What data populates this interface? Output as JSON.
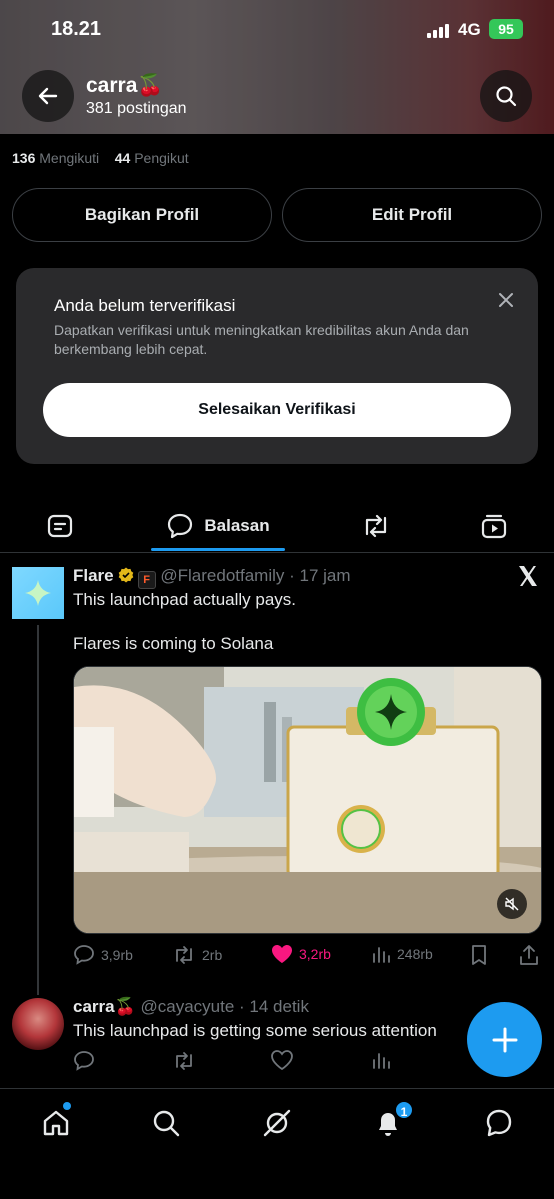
{
  "status_bar": {
    "time": "18.21",
    "network": "4G",
    "battery": "95"
  },
  "profile": {
    "name": "carra🍒",
    "posts": "381 postingan",
    "following_count": "136",
    "following_label": "Mengikuti",
    "followers_count": "44",
    "followers_label": "Pengikut"
  },
  "buttons": {
    "share": "Bagikan Profil",
    "edit": "Edit Profil"
  },
  "verification_card": {
    "title": "Anda belum terverifikasi",
    "description": "Dapatkan verifikasi untuk meningkatkan kredibilitas akun Anda dan berkembang lebih cepat.",
    "button": "Selesaikan Verifikasi"
  },
  "tabs": {
    "active_label": "Balasan"
  },
  "post": {
    "name": "Flare",
    "handle_time": "@Flaredotfamily · 17 jam",
    "line1": "This launchpad actually pays.",
    "line2": "Flares is coming to Solana",
    "replies": "3,9rb",
    "reposts": "2rb",
    "likes": "3,2rb",
    "views": "248rb"
  },
  "reply": {
    "name": "carra🍒",
    "handle_time": "@cayacyute · 14 detik",
    "text": "This launchpad is getting some serious attention"
  },
  "nav": {
    "notifications_badge": "1"
  },
  "colors": {
    "accent": "#1d9bf0",
    "like": "#f91880",
    "verified": "#e2b719"
  }
}
